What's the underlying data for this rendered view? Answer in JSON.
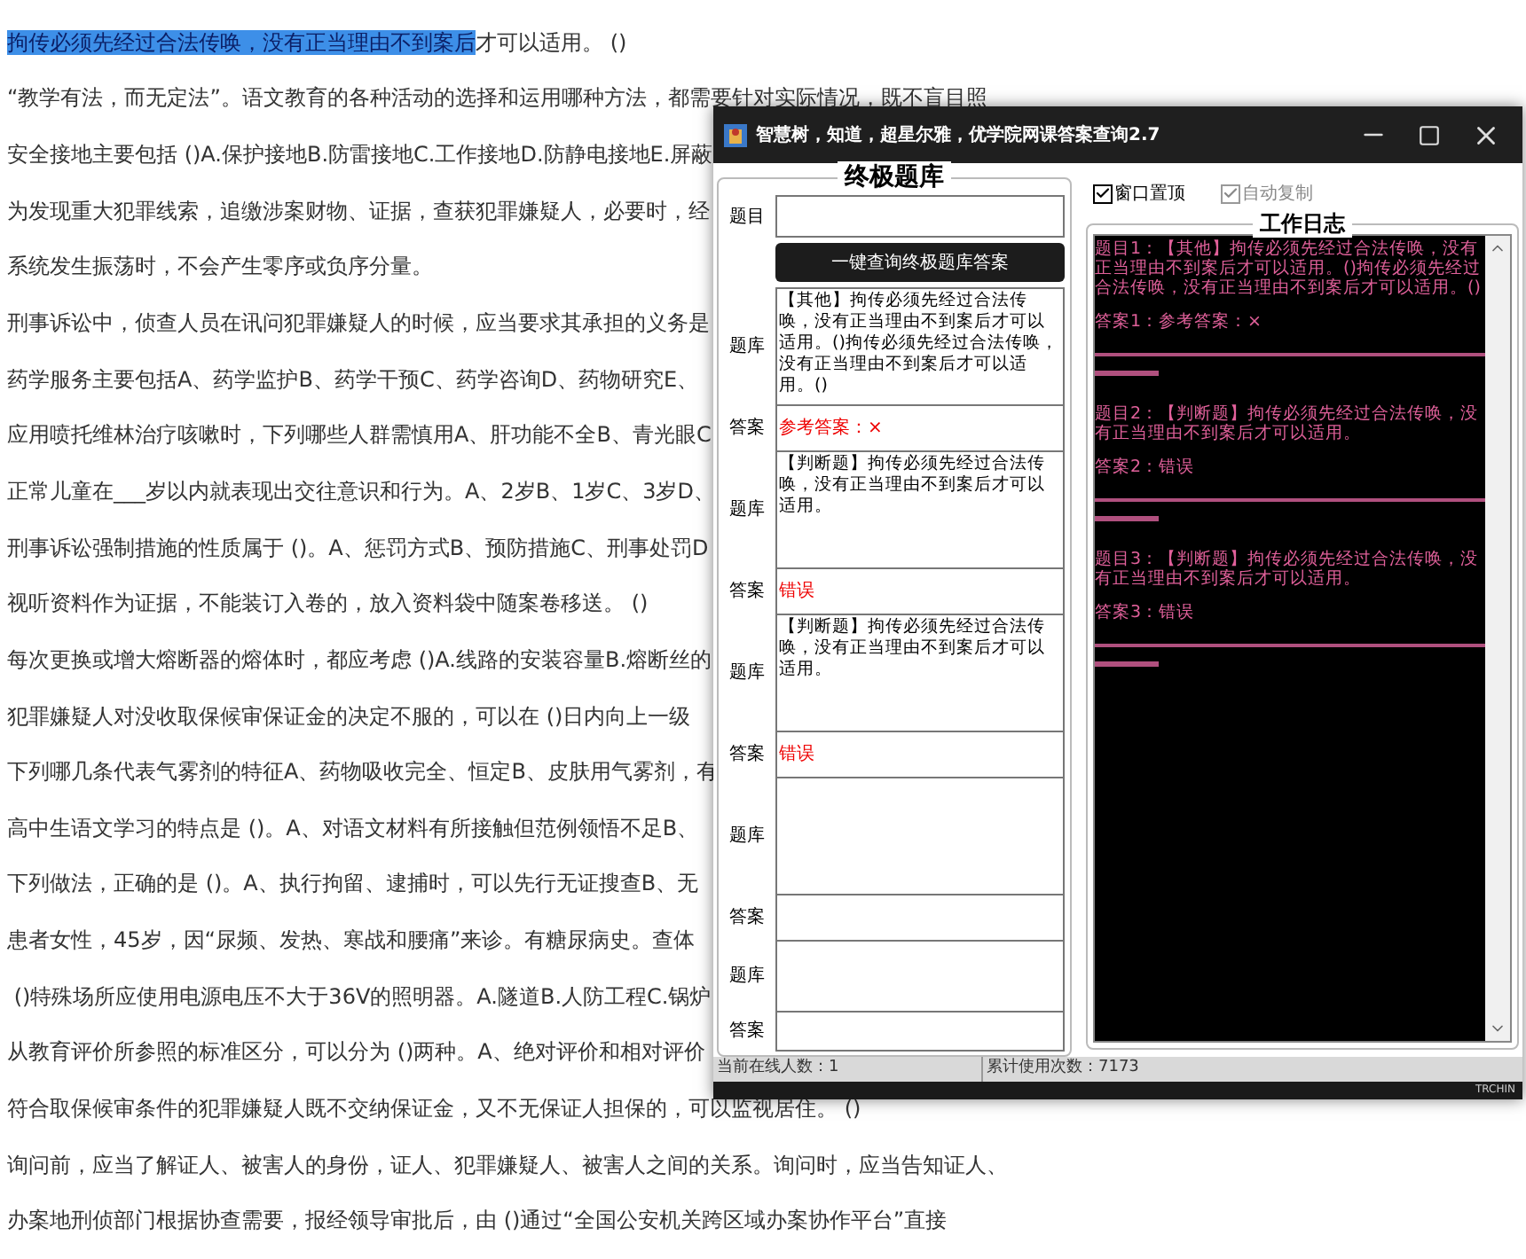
{
  "document": {
    "lines": [
      {
        "highlight": "拘传必须先经过合法传唤，没有正当理由不到案后",
        "text": "才可以适用。 ()"
      },
      {
        "text": "“教学有法，而无定法”。语文教育的各种活动的选择和运用哪种方法，都需要针对实际情况，既不盲目照"
      },
      {
        "text": "安全接地主要包括 ()A.保护接地B.防雷接地C.工作接地D.防静电接地E.屏蔽"
      },
      {
        "text": "为发现重大犯罪线索，追缴涉案财物、证据，查获犯罪嫌疑人，必要时，经"
      },
      {
        "text": "系统发生振荡时，不会产生零序或负序分量。"
      },
      {
        "text": "刑事诉讼中，侦查人员在讯问犯罪嫌疑人的时候，应当要求其承担的义务是"
      },
      {
        "text": "药学服务主要包括A、药学监护B、药学干预C、药学咨询D、药物研究E、"
      },
      {
        "text": "应用喷托维林治疗咳嗽时，下列哪些人群需慎用A、肝功能不全B、青光眼C"
      },
      {
        "text": "正常儿童在___岁以内就表现出交往意识和行为。A、2岁B、1岁C、3岁D、"
      },
      {
        "text": "刑事诉讼强制措施的性质属于 ()。A、惩罚方式B、预防措施C、刑事处罚D"
      },
      {
        "text": "视听资料作为证据，不能装订入卷的，放入资料袋中随案卷移送。 ()"
      },
      {
        "text": "每次更换或增大熔断器的熔体时，都应考虑 ()A.线路的安装容量B.熔断丝的"
      },
      {
        "text": "犯罪嫌疑人对没收取保候审保证金的决定不服的，可以在 ()日内向上一级"
      },
      {
        "text": "下列哪几条代表气雾剂的特征A、药物吸收完全、恒定B、皮肤用气雾剂，有"
      },
      {
        "text": "高中生语文学习的特点是 ()。A、对语文材料有所接触但范例领悟不足B、"
      },
      {
        "text": "下列做法，正确的是 ()。A、执行拘留、逮捕时，可以先行无证搜查B、无"
      },
      {
        "text": "患者女性，45岁，因“尿频、发热、寒战和腰痛”来诊。有糖尿病史。查体"
      },
      {
        "text": " ()特殊场所应使用电源电压不大于36V的照明器。A.隧道B.人防工程C.锅炉"
      },
      {
        "text": "从教育评价所参照的标准区分，可以分为 ()两种。A、绝对评价和相对评价"
      },
      {
        "text": "符合取保候审条件的犯罪嫌疑人既不交纳保证金，又不无保证人担保的，可以监视居住。 ()"
      },
      {
        "text": "询问前，应当了解证人、被害人的身份，证人、犯罪嫌疑人、被害人之间的关系。询问时，应当告知证人、"
      },
      {
        "text": "办案地刑侦部门根据协查需要，报经领导审批后，由 ()通过“全国公安机关跨区域办案协作平台”直接"
      }
    ]
  },
  "window": {
    "title": "智慧树，知道，超星尔雅，优学院网课答案查询2.7",
    "left_panel": {
      "title": "终极题库",
      "question_label": "题目",
      "button": "一键查询终极题库答案",
      "results": [
        {
          "bank_label": "题库",
          "bank_text": "【其他】拘传必须先经过合法传唤，没有正当理由不到案后才可以适用。()拘传必须先经过合法传唤，没有正当理由不到案后才可以适用。()",
          "answer_label": "答案",
          "answer_text": "参考答案：×"
        },
        {
          "bank_label": "题库",
          "bank_text": "【判断题】拘传必须先经过合法传唤，没有正当理由不到案后才可以适用。",
          "answer_label": "答案",
          "answer_text": "错误"
        },
        {
          "bank_label": "题库",
          "bank_text": "【判断题】拘传必须先经过合法传唤，没有正当理由不到案后才可以适用。",
          "answer_label": "答案",
          "answer_text": "错误"
        },
        {
          "bank_label": "题库",
          "answer_label": "答案"
        },
        {
          "bank_label": "题库",
          "answer_label": "答案"
        }
      ]
    },
    "checkboxes": [
      {
        "label": "窗口置顶",
        "checked": true,
        "disabled": false
      },
      {
        "label": "自动复制",
        "checked": true,
        "disabled": true
      }
    ],
    "log": {
      "title": "工作日志",
      "entries": [
        {
          "question": "题目1：【其他】拘传必须先经过合法传唤，没有正当理由不到案后才可以适用。()拘传必须先经过合法传唤，没有正当理由不到案后才可以适用。()",
          "answer": "答案1：参考答案：×"
        },
        {
          "question": "题目2：【判断题】拘传必须先经过合法传唤，没有正当理由不到案后才可以适用。",
          "answer": "答案2：错误"
        },
        {
          "question": "题目3：【判断题】拘传必须先经过合法传唤，没有正当理由不到案后才可以适用。",
          "answer": "答案3：错误"
        }
      ]
    },
    "status_bar": {
      "online": "当前在线人数：1",
      "usage": "累计使用次数：7173"
    },
    "footer_brand": "TRCHIN"
  }
}
